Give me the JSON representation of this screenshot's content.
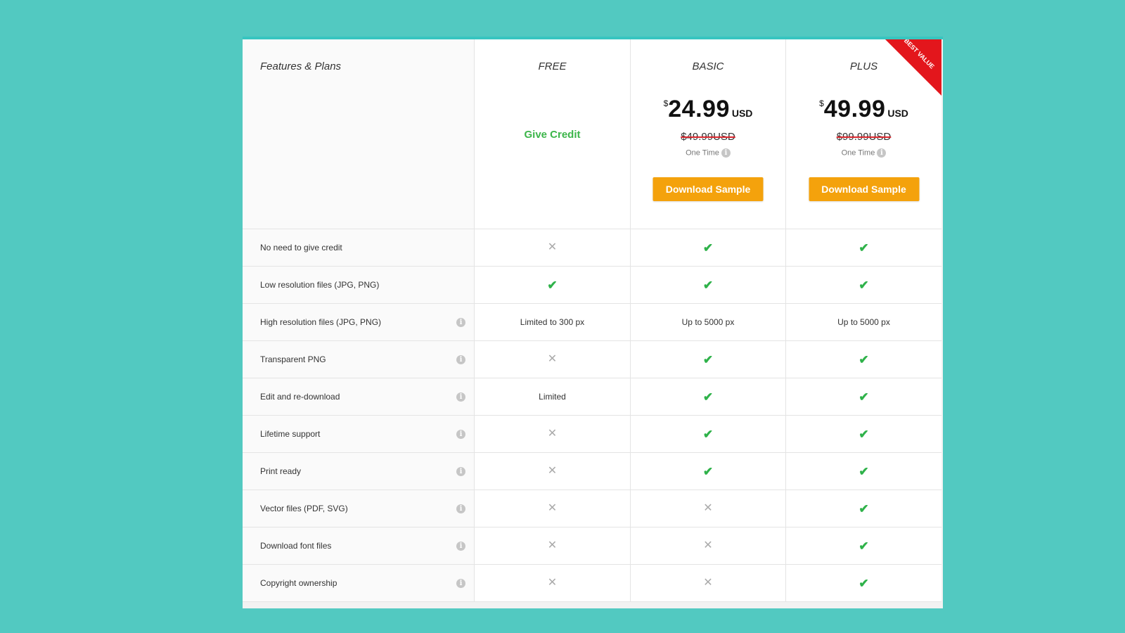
{
  "header": {
    "features_title": "Features & Plans",
    "plans": [
      {
        "name": "FREE",
        "give_credit": "Give Credit"
      },
      {
        "name": "BASIC",
        "currency_symbol": "$",
        "price": "24.99",
        "price_unit": "USD",
        "old_price": "$49.99USD",
        "billing": "One Time",
        "button_label": "Download Sample"
      },
      {
        "name": "PLUS",
        "currency_symbol": "$",
        "price": "49.99",
        "price_unit": "USD",
        "old_price": "$99.99USD",
        "billing": "One Time",
        "button_label": "Download Sample",
        "ribbon": "BEST VALUE"
      }
    ]
  },
  "info_glyph": "i",
  "rows": [
    {
      "feature": "No need to give credit",
      "info": false,
      "free": {
        "type": "cross"
      },
      "basic": {
        "type": "check"
      },
      "plus": {
        "type": "check"
      }
    },
    {
      "feature": "Low resolution files (JPG, PNG)",
      "info": false,
      "free": {
        "type": "check"
      },
      "basic": {
        "type": "check"
      },
      "plus": {
        "type": "check"
      }
    },
    {
      "feature": "High resolution files (JPG, PNG)",
      "info": true,
      "free": {
        "type": "text",
        "text": "Limited to 300 px"
      },
      "basic": {
        "type": "text",
        "text": "Up to 5000 px"
      },
      "plus": {
        "type": "text",
        "text": "Up to 5000 px"
      }
    },
    {
      "feature": "Transparent PNG",
      "info": true,
      "free": {
        "type": "cross"
      },
      "basic": {
        "type": "check"
      },
      "plus": {
        "type": "check"
      }
    },
    {
      "feature": "Edit and re-download",
      "info": true,
      "free": {
        "type": "text",
        "text": "Limited"
      },
      "basic": {
        "type": "check"
      },
      "plus": {
        "type": "check"
      }
    },
    {
      "feature": "Lifetime support",
      "info": true,
      "free": {
        "type": "cross"
      },
      "basic": {
        "type": "check"
      },
      "plus": {
        "type": "check"
      }
    },
    {
      "feature": "Print ready",
      "info": true,
      "free": {
        "type": "cross"
      },
      "basic": {
        "type": "check"
      },
      "plus": {
        "type": "check"
      }
    },
    {
      "feature": "Vector files (PDF, SVG)",
      "info": true,
      "free": {
        "type": "cross"
      },
      "basic": {
        "type": "cross"
      },
      "plus": {
        "type": "check"
      }
    },
    {
      "feature": "Download font files",
      "info": true,
      "free": {
        "type": "cross"
      },
      "basic": {
        "type": "cross"
      },
      "plus": {
        "type": "check"
      }
    },
    {
      "feature": "Copyright ownership",
      "info": true,
      "free": {
        "type": "cross"
      },
      "basic": {
        "type": "cross"
      },
      "plus": {
        "type": "check"
      }
    }
  ],
  "glyphs": {
    "check": "✔",
    "cross": "✕"
  },
  "colors": {
    "background": "#52c9c1",
    "check": "#2fb24a",
    "cross": "#aaaaaa",
    "button": "#f4a20c",
    "ribbon": "#e3161c",
    "give_credit": "#3cb54a",
    "strike": "#d9272e"
  }
}
